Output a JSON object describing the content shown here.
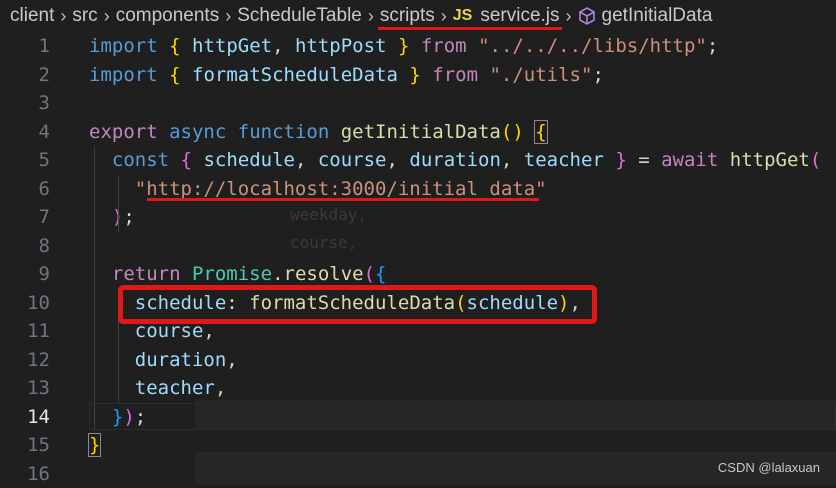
{
  "breadcrumb": {
    "items": [
      "client",
      "src",
      "components",
      "ScheduleTable",
      "scripts",
      "service.js",
      "getInitialData"
    ],
    "file_type_icon": "JS"
  },
  "editor": {
    "active_line": 14,
    "lines": [
      {
        "n": "1",
        "tokens": [
          [
            "kw",
            "import"
          ],
          [
            "pl",
            " "
          ],
          [
            "b1",
            "{"
          ],
          [
            "pl",
            " "
          ],
          [
            "var",
            "httpGet"
          ],
          [
            "pl",
            ", "
          ],
          [
            "var",
            "httpPost"
          ],
          [
            "pl",
            " "
          ],
          [
            "b1",
            "}"
          ],
          [
            "pl",
            " "
          ],
          [
            "ctl",
            "from"
          ],
          [
            "pl",
            " "
          ],
          [
            "str",
            "\"../../../libs/http\""
          ],
          [
            "pl",
            ";"
          ]
        ]
      },
      {
        "n": "2",
        "tokens": [
          [
            "kw",
            "import"
          ],
          [
            "pl",
            " "
          ],
          [
            "b1",
            "{"
          ],
          [
            "pl",
            " "
          ],
          [
            "var",
            "formatScheduleData"
          ],
          [
            "pl",
            " "
          ],
          [
            "b1",
            "}"
          ],
          [
            "pl",
            " "
          ],
          [
            "ctl",
            "from"
          ],
          [
            "pl",
            " "
          ],
          [
            "str",
            "\"./utils\""
          ],
          [
            "pl",
            ";"
          ]
        ]
      },
      {
        "n": "3",
        "tokens": []
      },
      {
        "n": "4",
        "tokens": [
          [
            "ctl",
            "export"
          ],
          [
            "pl",
            " "
          ],
          [
            "kw",
            "async"
          ],
          [
            "pl",
            " "
          ],
          [
            "kw",
            "function"
          ],
          [
            "pl",
            " "
          ],
          [
            "fn",
            "getInitialData"
          ],
          [
            "b1",
            "()"
          ],
          [
            "pl",
            " "
          ],
          [
            "b1",
            "{"
          ]
        ]
      },
      {
        "n": "5",
        "tokens": [
          [
            "pl",
            "  "
          ],
          [
            "kw",
            "const"
          ],
          [
            "pl",
            " "
          ],
          [
            "b2",
            "{"
          ],
          [
            "pl",
            " "
          ],
          [
            "var",
            "schedule"
          ],
          [
            "pl",
            ", "
          ],
          [
            "var",
            "course"
          ],
          [
            "pl",
            ", "
          ],
          [
            "var",
            "duration"
          ],
          [
            "pl",
            ", "
          ],
          [
            "var",
            "teacher"
          ],
          [
            "pl",
            " "
          ],
          [
            "b2",
            "}"
          ],
          [
            "pl",
            " = "
          ],
          [
            "ctl",
            "await"
          ],
          [
            "pl",
            " "
          ],
          [
            "fn",
            "httpGet"
          ],
          [
            "b2",
            "("
          ]
        ]
      },
      {
        "n": "6",
        "tokens": [
          [
            "pl",
            "    "
          ],
          [
            "str",
            "\"http://localhost:3000/initial_data\""
          ]
        ]
      },
      {
        "n": "7",
        "tokens": [
          [
            "pl",
            "  "
          ],
          [
            "b2",
            ")"
          ],
          [
            "pl",
            ";"
          ]
        ]
      },
      {
        "n": "8",
        "tokens": []
      },
      {
        "n": "9",
        "tokens": [
          [
            "pl",
            "  "
          ],
          [
            "ctl",
            "return"
          ],
          [
            "pl",
            " "
          ],
          [
            "cls",
            "Promise"
          ],
          [
            "pl",
            "."
          ],
          [
            "fn",
            "resolve"
          ],
          [
            "b2",
            "("
          ],
          [
            "b3",
            "{"
          ]
        ]
      },
      {
        "n": "10",
        "tokens": [
          [
            "pl",
            "    "
          ],
          [
            "var",
            "schedule"
          ],
          [
            "pl",
            ": "
          ],
          [
            "fn",
            "formatScheduleData"
          ],
          [
            "b1",
            "("
          ],
          [
            "var",
            "schedule"
          ],
          [
            "b1",
            ")"
          ],
          [
            "pl",
            ","
          ]
        ]
      },
      {
        "n": "11",
        "tokens": [
          [
            "pl",
            "    "
          ],
          [
            "var",
            "course"
          ],
          [
            "pl",
            ","
          ]
        ]
      },
      {
        "n": "12",
        "tokens": [
          [
            "pl",
            "    "
          ],
          [
            "var",
            "duration"
          ],
          [
            "pl",
            ","
          ]
        ]
      },
      {
        "n": "13",
        "tokens": [
          [
            "pl",
            "    "
          ],
          [
            "var",
            "teacher"
          ],
          [
            "pl",
            ","
          ]
        ]
      },
      {
        "n": "14",
        "tokens": [
          [
            "pl",
            "  "
          ],
          [
            "b3",
            "}"
          ],
          [
            "b2",
            ")"
          ],
          [
            "pl",
            ";"
          ]
        ]
      },
      {
        "n": "15",
        "tokens": [
          [
            "b1",
            "}"
          ]
        ]
      },
      {
        "n": "16",
        "tokens": []
      }
    ]
  },
  "watermark": "CSDN @lalaxuan",
  "colors": {
    "annotation": "#e01818",
    "background": "#1f1f1f"
  }
}
